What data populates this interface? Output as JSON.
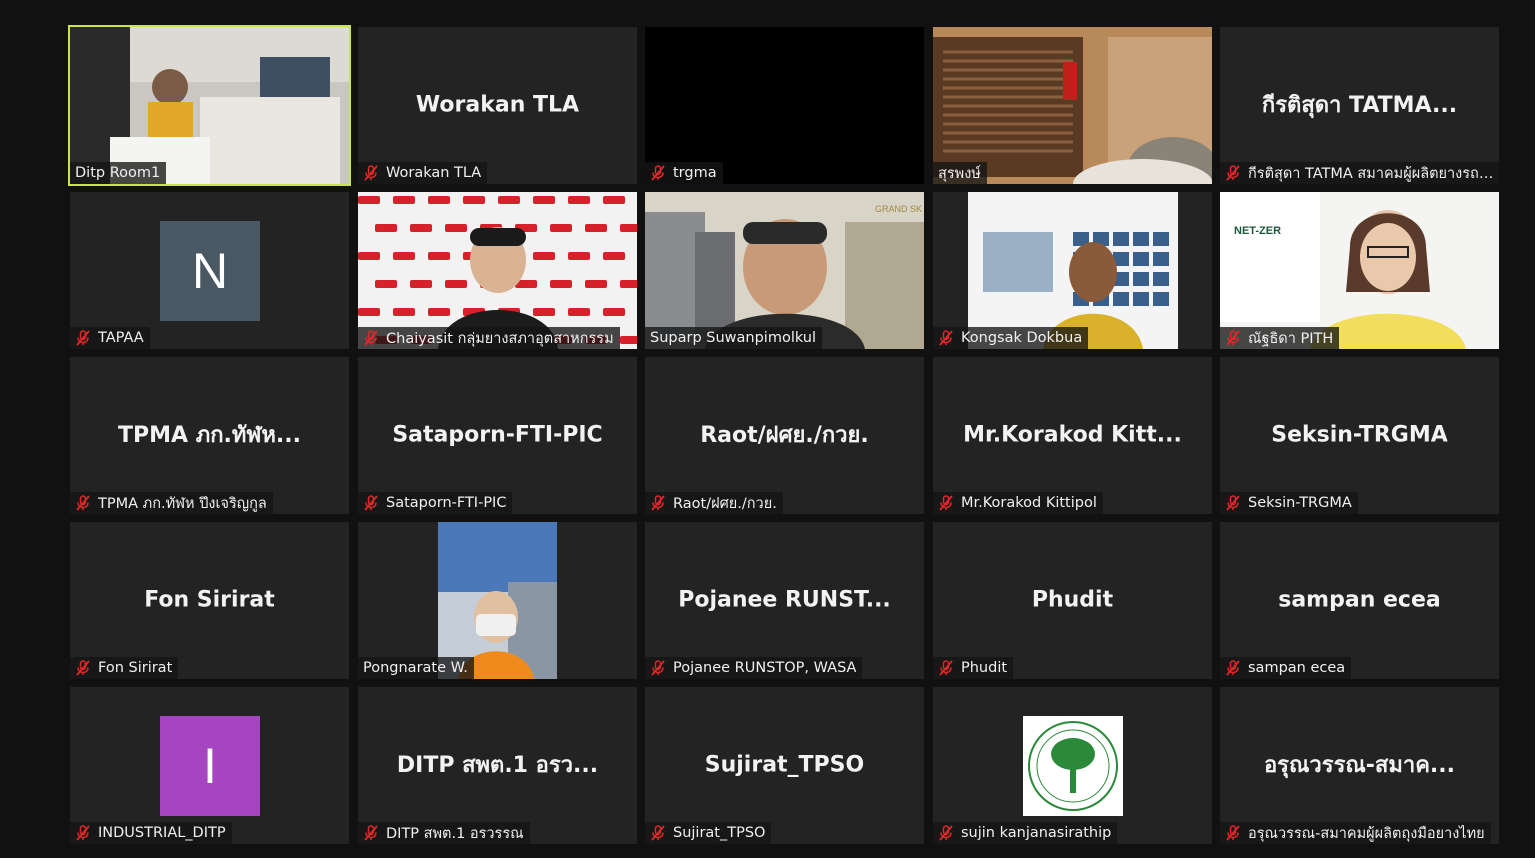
{
  "tiles": [
    {
      "id": "t1",
      "display_name": "",
      "label": "Ditp Room1",
      "muted": false,
      "kind": "video",
      "active": true
    },
    {
      "id": "t2",
      "display_name": "Worakan TLA",
      "label": "Worakan TLA",
      "muted": true,
      "kind": "name"
    },
    {
      "id": "t3",
      "display_name": "",
      "label": "trgma",
      "muted": true,
      "kind": "black"
    },
    {
      "id": "t4",
      "display_name": "",
      "label": "สุรพงษ์",
      "muted": false,
      "kind": "video"
    },
    {
      "id": "t5",
      "display_name": "กีรติสุดา TATMA...",
      "label": "กีรติสุดา TATMA สมาคมผู้ผลิตยางรถย...",
      "muted": true,
      "kind": "name"
    },
    {
      "id": "t6",
      "display_name": "",
      "label": "TAPAA",
      "muted": true,
      "kind": "avatar",
      "avatar_letter": "N",
      "avatar_color": "#4a5863"
    },
    {
      "id": "t7",
      "display_name": "",
      "label": "Chaiyasit กลุ่มยางสภาอุตสาหกรรม",
      "muted": true,
      "kind": "video"
    },
    {
      "id": "t8",
      "display_name": "",
      "label": "Suparp Suwanpimolkul",
      "muted": false,
      "kind": "video"
    },
    {
      "id": "t9",
      "display_name": "",
      "label": "Kongsak Dokbua",
      "muted": true,
      "kind": "video"
    },
    {
      "id": "t10",
      "display_name": "",
      "label": "ณัฐธิดา PITH",
      "muted": true,
      "kind": "video"
    },
    {
      "id": "t11",
      "display_name": "TPMA ภก.ทัฬห...",
      "label": "TPMA ภก.ทัฬห ปึงเจริญกูล",
      "muted": true,
      "kind": "name"
    },
    {
      "id": "t12",
      "display_name": "Sataporn-FTI-PIC",
      "label": "Sataporn-FTI-PIC",
      "muted": true,
      "kind": "name"
    },
    {
      "id": "t13",
      "display_name": "Raot/ฝศย./กวย.",
      "label": "Raot/ฝศย./กวย.",
      "muted": true,
      "kind": "name"
    },
    {
      "id": "t14",
      "display_name": "Mr.Korakod  Kitt...",
      "label": "Mr.Korakod Kittipol",
      "muted": true,
      "kind": "name"
    },
    {
      "id": "t15",
      "display_name": "Seksin-TRGMA",
      "label": "Seksin-TRGMA",
      "muted": true,
      "kind": "name"
    },
    {
      "id": "t16",
      "display_name": "Fon Sirirat",
      "label": "Fon Sirirat",
      "muted": true,
      "kind": "name"
    },
    {
      "id": "t17",
      "display_name": "",
      "label": "Pongnarate W.",
      "muted": false,
      "kind": "video"
    },
    {
      "id": "t18",
      "display_name": "Pojanee  RUNST...",
      "label": "Pojanee RUNSTOP, WASA",
      "muted": true,
      "kind": "name"
    },
    {
      "id": "t19",
      "display_name": "Phudit",
      "label": "Phudit",
      "muted": true,
      "kind": "name"
    },
    {
      "id": "t20",
      "display_name": "sampan ecea",
      "label": "sampan ecea",
      "muted": true,
      "kind": "name"
    },
    {
      "id": "t21",
      "display_name": "",
      "label": "INDUSTRIAL_DITP",
      "muted": true,
      "kind": "avatar",
      "avatar_letter": "I",
      "avatar_color": "#a645c0"
    },
    {
      "id": "t22",
      "display_name": "DITP  สพต.1 อรว...",
      "label": "DITP สพต.1 อรวรรณ",
      "muted": true,
      "kind": "name"
    },
    {
      "id": "t23",
      "display_name": "Sujirat_TPSO",
      "label": "Sujirat_TPSO",
      "muted": true,
      "kind": "name"
    },
    {
      "id": "t24",
      "display_name": "",
      "label": "sujin kanjanasirathip",
      "muted": true,
      "kind": "logo"
    },
    {
      "id": "t25",
      "display_name": "อรุณวรรณ-สมาค...",
      "label": "อรุณวรรณ-สมาคมผู้ผลิตถุงมือยางไทย",
      "muted": true,
      "kind": "name"
    }
  ],
  "colors": {
    "background": "#111111",
    "tile": "#232323",
    "active_border": "#c8e646",
    "mute_red": "#e02828"
  },
  "icons": {
    "mute": "mic-muted-icon"
  }
}
